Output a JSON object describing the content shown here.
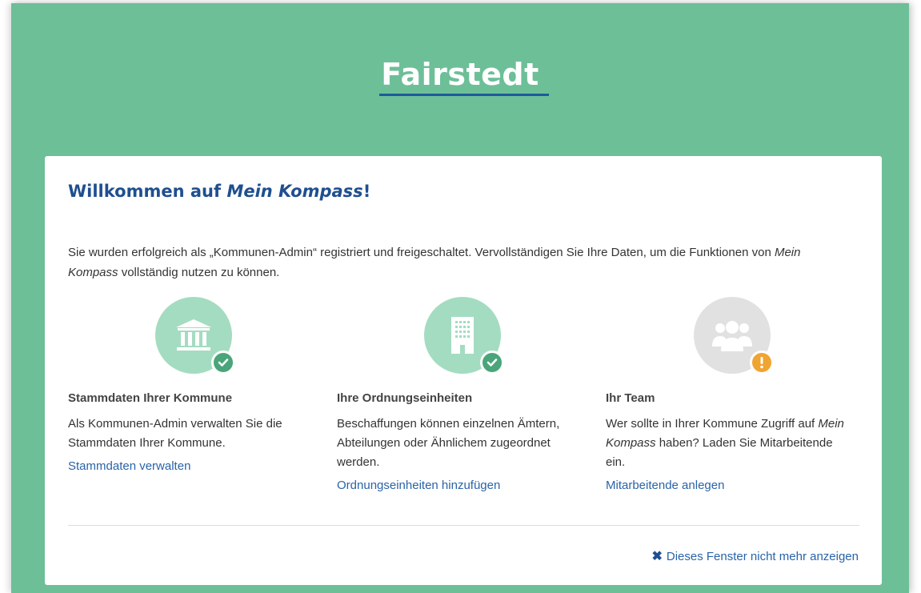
{
  "header": {
    "title": "Fairstedt"
  },
  "welcome": {
    "prefix": "Willkommen auf ",
    "product": "Mein Kompass",
    "suffix": "!"
  },
  "intro": {
    "part1": "Sie wurden erfolgreich als „Kommunen-Admin“ registriert und freigeschaltet. Vervollständigen Sie Ihre Daten, um die Funktionen von ",
    "product": "Mein Kompass",
    "part2": " vollständig nutzen zu können."
  },
  "columns": [
    {
      "icon": "bank-icon",
      "status": "complete",
      "title": "Stammdaten Ihrer Kommune",
      "text": "Als Kommunen-Admin verwalten Sie die Stammdaten Ihrer Kommune.",
      "link": "Stammdaten verwalten"
    },
    {
      "icon": "building-icon",
      "status": "complete",
      "title": "Ihre Ordnungseinheiten",
      "text": "Beschaffungen können einzelnen Ämtern, Abteilungen oder Ähnlichem zugeordnet werden.",
      "link": "Ordnungseinheiten hinzufügen"
    },
    {
      "icon": "team-icon",
      "status": "warning",
      "title": "Ihr Team",
      "text_part1": "Wer sollte in Ihrer Kommune Zugriff auf ",
      "text_product": "Mein Kompass",
      "text_part2": " haben? Laden Sie Mitarbeitende ein.",
      "link": "Mitarbeitende anlegen"
    }
  ],
  "footer": {
    "dismiss_icon": "✖",
    "dismiss_label": "Dieses Fenster nicht mehr anzeigen"
  },
  "colors": {
    "background": "#6dbf98",
    "heading": "#1f4f8f",
    "link": "#2a63a8",
    "icon_green": "#a4dcc1",
    "check_badge": "#4aa57a",
    "warn_badge": "#f0a431"
  }
}
